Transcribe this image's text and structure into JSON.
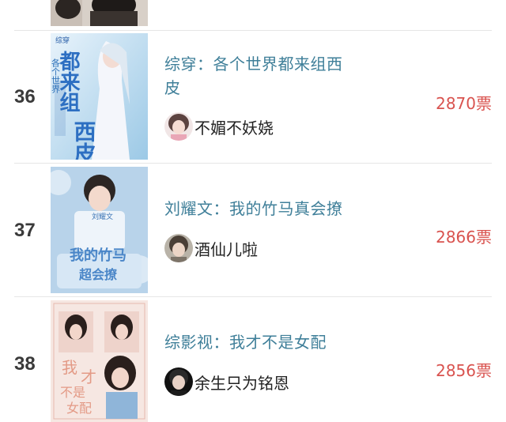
{
  "items": [
    {
      "rank": "36",
      "title": "综穿：各个世界都来组西皮",
      "author": "不媚不妖娆",
      "votes": "2870票",
      "cover_text": [
        "综穿",
        "各个世界",
        "都来组",
        "西皮"
      ]
    },
    {
      "rank": "37",
      "title": "刘耀文：我的竹马真会撩",
      "author": "酒仙儿啦",
      "votes": "2866票",
      "cover_text": [
        "刘耀文",
        "我的竹马",
        "超会撩"
      ]
    },
    {
      "rank": "38",
      "title": "综影视：我才不是女配",
      "author": "余生只为铭恩",
      "votes": "2856票",
      "cover_text": [
        "我",
        "才",
        "不是",
        "女配"
      ]
    }
  ],
  "colors": {
    "rank": "#3a3a3a",
    "title": "#3f7f99",
    "votes": "#d9534f",
    "separator": "#e6e6e6"
  }
}
